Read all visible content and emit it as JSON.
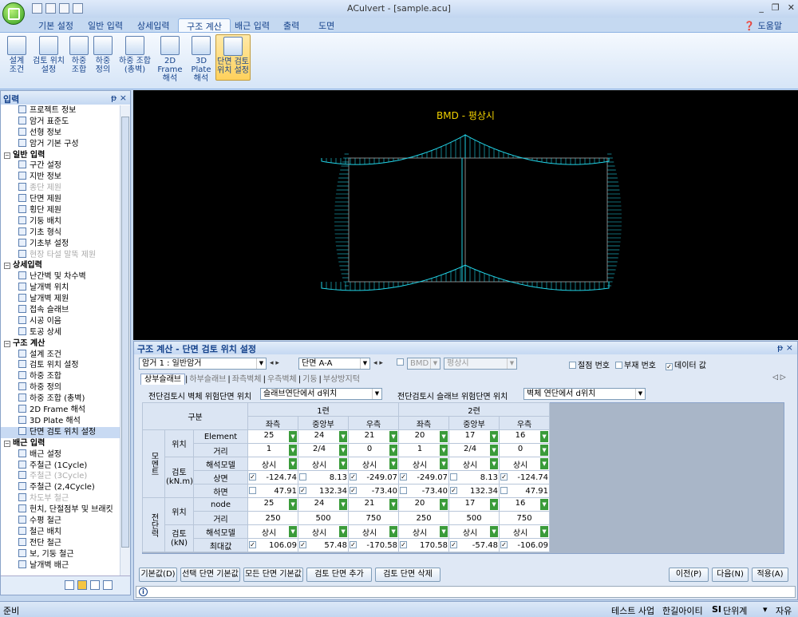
{
  "window": {
    "title": "ACulvert - [sample.acu]",
    "help": "도움말"
  },
  "ribbon": {
    "tabs": [
      "기본 설정",
      "일반 입력",
      "상세입력",
      "구조 계산",
      "배근 입력",
      "출력",
      "도면"
    ],
    "buttons": [
      {
        "label": "설계\n조건"
      },
      {
        "label": "검토 위치\n설정"
      },
      {
        "label": "하중\n조합"
      },
      {
        "label": "하중\n정의"
      },
      {
        "label": "하중 조합\n(총벽)"
      },
      {
        "label": "2D Frame\n해석"
      },
      {
        "label": "3D Plate\n해석"
      },
      {
        "label": "단면 검토\n위치 설정"
      }
    ]
  },
  "left": {
    "title": "입력",
    "pin": "ᵽ ×",
    "tree": [
      {
        "t": "프로젝트 정보",
        "k": "i"
      },
      {
        "t": "암거 표준도",
        "k": "i"
      },
      {
        "t": "선형 정보",
        "k": "i"
      },
      {
        "t": "암거 기본 구성",
        "k": "i"
      },
      {
        "t": "일반 입력",
        "k": "g"
      },
      {
        "t": "구간 설정",
        "k": "i"
      },
      {
        "t": "지반 정보",
        "k": "i"
      },
      {
        "t": "종단 제원",
        "k": "d"
      },
      {
        "t": "단면 제원",
        "k": "i"
      },
      {
        "t": "횡단 제원",
        "k": "i"
      },
      {
        "t": "기둥 배치",
        "k": "i"
      },
      {
        "t": "기초 형식",
        "k": "i"
      },
      {
        "t": "기초부 설정",
        "k": "i"
      },
      {
        "t": "현장 타설 말뚝 제원",
        "k": "d"
      },
      {
        "t": "상세입력",
        "k": "g"
      },
      {
        "t": "난간벽 및 차수벽",
        "k": "i"
      },
      {
        "t": "날개벽 위치",
        "k": "i"
      },
      {
        "t": "날개벽 제원",
        "k": "i"
      },
      {
        "t": "접속 슬래브",
        "k": "i"
      },
      {
        "t": "시공 이음",
        "k": "i"
      },
      {
        "t": "토공 상세",
        "k": "i"
      },
      {
        "t": "구조 계산",
        "k": "g"
      },
      {
        "t": "설계 조건",
        "k": "i"
      },
      {
        "t": "검토 위치 설정",
        "k": "i"
      },
      {
        "t": "하중 조합",
        "k": "i"
      },
      {
        "t": "하중 정의",
        "k": "i"
      },
      {
        "t": "하중 조합 (총벽)",
        "k": "i"
      },
      {
        "t": "2D Frame 해석",
        "k": "i"
      },
      {
        "t": "3D Plate 해석",
        "k": "i"
      },
      {
        "t": "단면 검토 위치 설정",
        "k": "s"
      },
      {
        "t": "배근 입력",
        "k": "g"
      },
      {
        "t": "배근 설정",
        "k": "i"
      },
      {
        "t": "주철근 (1Cycle)",
        "k": "i"
      },
      {
        "t": "주철근 (3Cycle)",
        "k": "d"
      },
      {
        "t": "주철근 (2,4Cycle)",
        "k": "i"
      },
      {
        "t": "차도부 철근",
        "k": "d"
      },
      {
        "t": "헌치, 단절점부 및 브래킷",
        "k": "i"
      },
      {
        "t": "수평 철근",
        "k": "i"
      },
      {
        "t": "철근 배치",
        "k": "i"
      },
      {
        "t": "전단 철근",
        "k": "i"
      },
      {
        "t": "보, 기둥 철근",
        "k": "i"
      },
      {
        "t": "날개벽 배근",
        "k": "i"
      }
    ]
  },
  "cad": {
    "title": "BMD - 평상시"
  },
  "panel": {
    "title": "구조 계산 - 단면 검토 위치 설정",
    "pin": "ᵽ ×",
    "culvert": "암거 1 : 일반암거",
    "section": "단면 A-A",
    "bmd": "BMD",
    "normal": "평상시",
    "opt_node": "절점 번호",
    "opt_member": "부재 번호",
    "opt_data": "데이터 값",
    "subtabs": [
      "상부슬래브",
      "하부슬래브",
      "좌측벽체",
      "우측벽체",
      "기둥",
      "부상방지턱"
    ],
    "shear_wall_label": "전단검토시 벽체 위험단면 위치",
    "shear_wall_value": "슬래브연단에서 d위치",
    "shear_slab_label": "전단검토시 슬래브 위험단면 위치",
    "shear_slab_value": "벽체 연단에서 d위치",
    "grid": {
      "gubun": "구분",
      "span1": "1련",
      "span2": "2련",
      "left": "좌측",
      "mid": "중앙부",
      "right": "우측",
      "moment": "모멘트",
      "shear": "전단력",
      "pos": "위치",
      "check_knm": "검토\n(kN.m)",
      "check_kn": "검토\n(kN)",
      "element": "Element",
      "dist": "거리",
      "model": "해석모델",
      "top": "상면",
      "bot": "하면",
      "node": "node",
      "max": "최대값",
      "m_elem": [
        "25",
        "24",
        "21",
        "20",
        "17",
        "16"
      ],
      "m_dist": [
        "1",
        "2/4",
        "0",
        "1",
        "2/4",
        "0"
      ],
      "m_model": [
        "상시",
        "상시",
        "상시",
        "상시",
        "상시",
        "상시"
      ],
      "m_top": [
        "-124.74",
        "8.13",
        "-249.07",
        "-249.07",
        "8.13",
        "-124.74"
      ],
      "m_bot": [
        "47.91",
        "132.34",
        "-73.40",
        "-73.40",
        "132.34",
        "47.91"
      ],
      "s_node": [
        "25",
        "24",
        "21",
        "20",
        "17",
        "16"
      ],
      "s_dist": [
        "250",
        "500",
        "750",
        "250",
        "500",
        "750"
      ],
      "s_model": [
        "상시",
        "상시",
        "상시",
        "상시",
        "상시",
        "상시"
      ],
      "s_max": [
        "106.09",
        "57.48",
        "-170.58",
        "170.58",
        "-57.48",
        "-106.09"
      ]
    },
    "buttons": {
      "default": "기본값(D)",
      "sel_default": "선택 단면 기본값",
      "all_default": "모든 단면 기본값",
      "add": "검토 단면 추가",
      "del": "검토 단면 삭제",
      "prev": "이전(P)",
      "next": "다음(N)",
      "apply": "적용(A)"
    }
  },
  "status": {
    "ready": "준비",
    "test": "테스트 사업",
    "hangil": "한길아이티",
    "si": "SI",
    "unit": "단위계",
    "auto": "자유"
  }
}
